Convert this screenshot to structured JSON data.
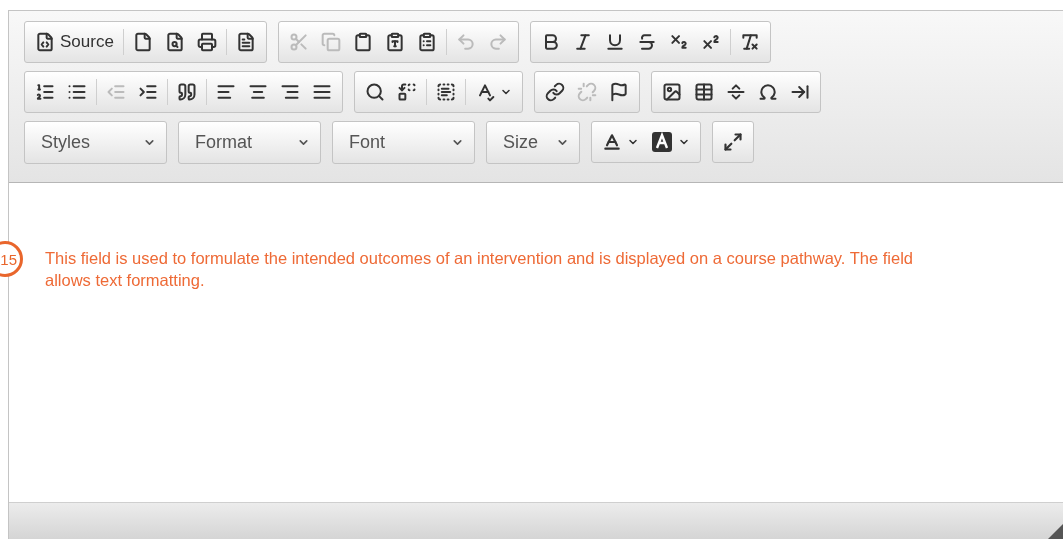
{
  "toolbar": {
    "rows": [
      {
        "groups": [
          [
            {
              "kind": "source",
              "label": "Source",
              "disabled": false
            },
            {
              "kind": "separator"
            },
            {
              "kind": "new-page",
              "disabled": false
            },
            {
              "kind": "preview",
              "disabled": false
            },
            {
              "kind": "print",
              "disabled": false
            },
            {
              "kind": "separator"
            },
            {
              "kind": "templates",
              "disabled": false
            }
          ],
          [
            {
              "kind": "cut",
              "disabled": true
            },
            {
              "kind": "copy",
              "disabled": true
            },
            {
              "kind": "paste",
              "disabled": false
            },
            {
              "kind": "paste-text",
              "disabled": false
            },
            {
              "kind": "paste-word",
              "disabled": false
            },
            {
              "kind": "separator"
            },
            {
              "kind": "undo",
              "disabled": true
            },
            {
              "kind": "redo",
              "disabled": true
            }
          ],
          [
            {
              "kind": "bold",
              "disabled": false
            },
            {
              "kind": "italic",
              "disabled": false
            },
            {
              "kind": "underline",
              "disabled": false
            },
            {
              "kind": "strike",
              "disabled": false
            },
            {
              "kind": "subscript",
              "disabled": false
            },
            {
              "kind": "superscript",
              "disabled": false
            },
            {
              "kind": "separator"
            },
            {
              "kind": "clear-format",
              "disabled": false
            }
          ]
        ]
      },
      {
        "groups": [
          [
            {
              "kind": "numbered-list",
              "disabled": false
            },
            {
              "kind": "bulleted-list",
              "disabled": false
            },
            {
              "kind": "separator"
            },
            {
              "kind": "outdent",
              "disabled": true
            },
            {
              "kind": "indent",
              "disabled": false
            },
            {
              "kind": "separator"
            },
            {
              "kind": "quote",
              "disabled": false
            },
            {
              "kind": "separator"
            },
            {
              "kind": "align-left",
              "disabled": false
            },
            {
              "kind": "align-center",
              "disabled": false
            },
            {
              "kind": "align-right",
              "disabled": false
            },
            {
              "kind": "justify",
              "disabled": false
            }
          ],
          [
            {
              "kind": "find",
              "disabled": false
            },
            {
              "kind": "replace",
              "disabled": false
            },
            {
              "kind": "separator"
            },
            {
              "kind": "select-all",
              "disabled": false
            },
            {
              "kind": "separator"
            },
            {
              "kind": "spellcheck",
              "disabled": false
            }
          ],
          [
            {
              "kind": "link",
              "disabled": false
            },
            {
              "kind": "unlink",
              "disabled": true
            },
            {
              "kind": "anchor",
              "disabled": false
            }
          ],
          [
            {
              "kind": "image",
              "disabled": false
            },
            {
              "kind": "table",
              "disabled": false
            },
            {
              "kind": "rule",
              "disabled": false
            },
            {
              "kind": "special-char",
              "disabled": false
            },
            {
              "kind": "page-break",
              "disabled": false
            }
          ]
        ]
      }
    ],
    "combos": [
      {
        "label": "Styles",
        "kind": "wide"
      },
      {
        "label": "Format",
        "kind": "wide"
      },
      {
        "label": "Font",
        "kind": "wide"
      },
      {
        "label": "Size",
        "kind": "narrow"
      }
    ],
    "color_buttons": [
      {
        "kind": "text-color"
      },
      {
        "kind": "background-color"
      }
    ],
    "maximize": {
      "disabled": false
    }
  },
  "content": {
    "badge": "15",
    "text": "This field is used to formulate the intended outcomes of an intervention and is displayed on a course pathway.  The field allows text formatting."
  }
}
